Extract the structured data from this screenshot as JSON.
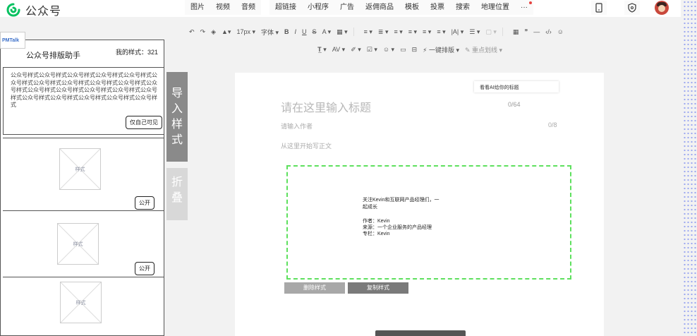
{
  "brand": {
    "name": "公众号",
    "accent": "#07c160"
  },
  "topbar": {
    "menu": [
      "图片",
      "视频",
      "音频",
      "超链接",
      "小程序",
      "广告",
      "返佣商品",
      "模板",
      "投票",
      "搜索",
      "地理位置",
      "···"
    ],
    "icons": [
      "mobile-preview-icon",
      "shield-icon",
      "avatar"
    ]
  },
  "toolbar": {
    "row1": [
      "↶",
      "↷",
      "◈",
      "▲▾",
      "17px ▾",
      "字体 ▾",
      "B",
      "I",
      "U",
      "S",
      "A ▾",
      "▦ ▾",
      "≡ ▾",
      "≣ ▾",
      "≡ ▾",
      "≡ ▾",
      "≡ ▾",
      "≡ ▾",
      "|A| ▾",
      "☰ ▾",
      "▢ ▾",
      "▦",
      "❞",
      "—",
      "‹/›",
      "☺"
    ],
    "row2": [
      "𝐓̲ ▾",
      "AV ▾",
      "✐ ▾",
      "☑ ▾",
      "☺ ▾",
      "▭",
      "⊟",
      "⚡ 一键排版 ▾",
      "✎ 重点划线 ▾"
    ]
  },
  "panel": {
    "badge": "PMTalk",
    "title": "公众号排版助手",
    "count_label": "我的样式：321",
    "sample_text": "公众号样式公众号样式公众号样式公众号样式公众号样式公众号样式公众号样式公众号样式公众号样式公众号样式公众号样式公众号样式公众号样式公众号样式公众号样式公众号样式公众号样式公众号样式公众号样式公众号样式公众号样式",
    "private_label": "仅自己可见",
    "placeholder_label": "样式",
    "public_label": "公开"
  },
  "tabs": {
    "import": [
      "导",
      "入",
      "样",
      "式"
    ],
    "fold": [
      "折",
      "叠"
    ]
  },
  "editor": {
    "ai_hint": "看看AI给你的标题",
    "title_placeholder": "请在这里输入标题",
    "title_count": "0/64",
    "author_placeholder": "请输入作者",
    "author_count": "0/8",
    "body_placeholder": "从这里开始写正文",
    "box_line1": "关注Kevin和互联网产品经理们，一起成长",
    "box_author": "作者：Kevin",
    "box_source": "来源：一个企业服务的产品经理",
    "box_column": "专栏：Kevin",
    "delete_label": "删除样式",
    "copy_label": "复制样式"
  }
}
